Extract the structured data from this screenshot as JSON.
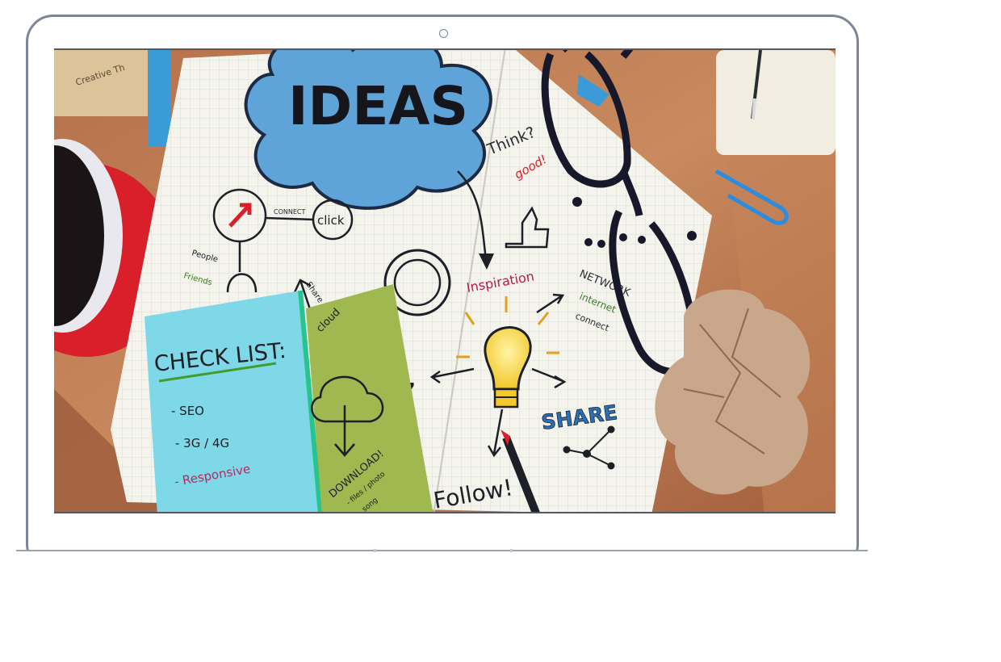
{
  "device": {
    "type": "laptop"
  },
  "screen_image": {
    "scene": "desk",
    "notebook": {
      "cloud_text": "IDEAS",
      "connect": "CONNECT",
      "click": "click",
      "people": "People",
      "friends": "Friends",
      "share_small": "Share",
      "think": "Think?",
      "good": "good!",
      "inspiration": "Inspiration",
      "network": "NETWORK",
      "internet": "internet",
      "connect2": "connect",
      "share": "SHARE",
      "follow": "Follow!",
      "quote": "”"
    },
    "checklist": {
      "title": "CHECK LIST:",
      "items": [
        "- SEO",
        "- 3G / 4G",
        "- Responsive"
      ]
    },
    "green_note": {
      "cloud": "cloud",
      "download": "DOWNLOAD!",
      "files": "- files / photo",
      "song": "- song"
    },
    "corner_note": "Creative Th"
  },
  "colors": {
    "frame": "#7c8696",
    "cloud": "#5fa4d8",
    "note_blue": "#7fd8e8",
    "note_green": "#9fb84f"
  }
}
